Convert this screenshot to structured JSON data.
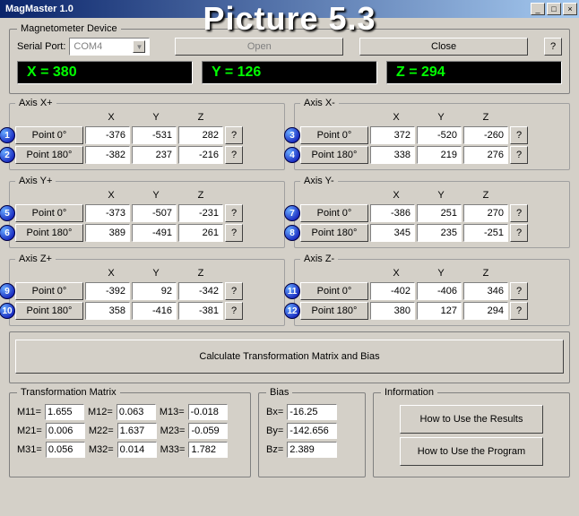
{
  "overlay": "Picture 5.3",
  "window": {
    "title": "MagMaster 1.0"
  },
  "device": {
    "legend": "Magnetometer Device",
    "serial_label": "Serial Port:",
    "serial_value": "COM4",
    "open": "Open",
    "close": "Close",
    "help": "?"
  },
  "readings": {
    "x": "X = 380",
    "y": "Y = 126",
    "z": "Z = 294"
  },
  "cols": {
    "x": "X",
    "y": "Y",
    "z": "Z"
  },
  "pt0": "Point 0°",
  "pt180": "Point 180°",
  "q": "?",
  "axes": {
    "xp": {
      "legend": "Axis X+",
      "b0": "1",
      "b180": "2",
      "p0": {
        "x": "-376",
        "y": "-531",
        "z": "282"
      },
      "p180": {
        "x": "-382",
        "y": "237",
        "z": "-216"
      }
    },
    "xm": {
      "legend": "Axis X-",
      "b0": "3",
      "b180": "4",
      "p0": {
        "x": "372",
        "y": "-520",
        "z": "-260"
      },
      "p180": {
        "x": "338",
        "y": "219",
        "z": "276"
      }
    },
    "yp": {
      "legend": "Axis Y+",
      "b0": "5",
      "b180": "6",
      "p0": {
        "x": "-373",
        "y": "-507",
        "z": "-231"
      },
      "p180": {
        "x": "389",
        "y": "-491",
        "z": "261"
      }
    },
    "ym": {
      "legend": "Axis Y-",
      "b0": "7",
      "b180": "8",
      "p0": {
        "x": "-386",
        "y": "251",
        "z": "270"
      },
      "p180": {
        "x": "345",
        "y": "235",
        "z": "-251"
      }
    },
    "zp": {
      "legend": "Axis Z+",
      "b0": "9",
      "b180": "10",
      "p0": {
        "x": "-392",
        "y": "92",
        "z": "-342"
      },
      "p180": {
        "x": "358",
        "y": "-416",
        "z": "-381"
      }
    },
    "zm": {
      "legend": "Axis Z-",
      "b0": "11",
      "b180": "12",
      "p0": {
        "x": "-402",
        "y": "-406",
        "z": "346"
      },
      "p180": {
        "x": "380",
        "y": "127",
        "z": "294"
      }
    }
  },
  "calc": "Calculate Transformation Matrix and Bias",
  "matrix": {
    "legend": "Transformation Matrix",
    "m11l": "M11=",
    "m11": "1.655",
    "m12l": "M12=",
    "m12": "0.063",
    "m13l": "M13=",
    "m13": "-0.018",
    "m21l": "M21=",
    "m21": "0.006",
    "m22l": "M22=",
    "m22": "1.637",
    "m23l": "M23=",
    "m23": "-0.059",
    "m31l": "M31=",
    "m31": "0.056",
    "m32l": "M32=",
    "m32": "0.014",
    "m33l": "M33=",
    "m33": "1.782"
  },
  "bias": {
    "legend": "Bias",
    "bxl": "Bx=",
    "bx": "-16.25",
    "byl": "By=",
    "by": "-142.656",
    "bzl": "Bz=",
    "bz": "2.389"
  },
  "info": {
    "legend": "Information",
    "results": "How to Use the Results",
    "program": "How to Use the Program"
  }
}
